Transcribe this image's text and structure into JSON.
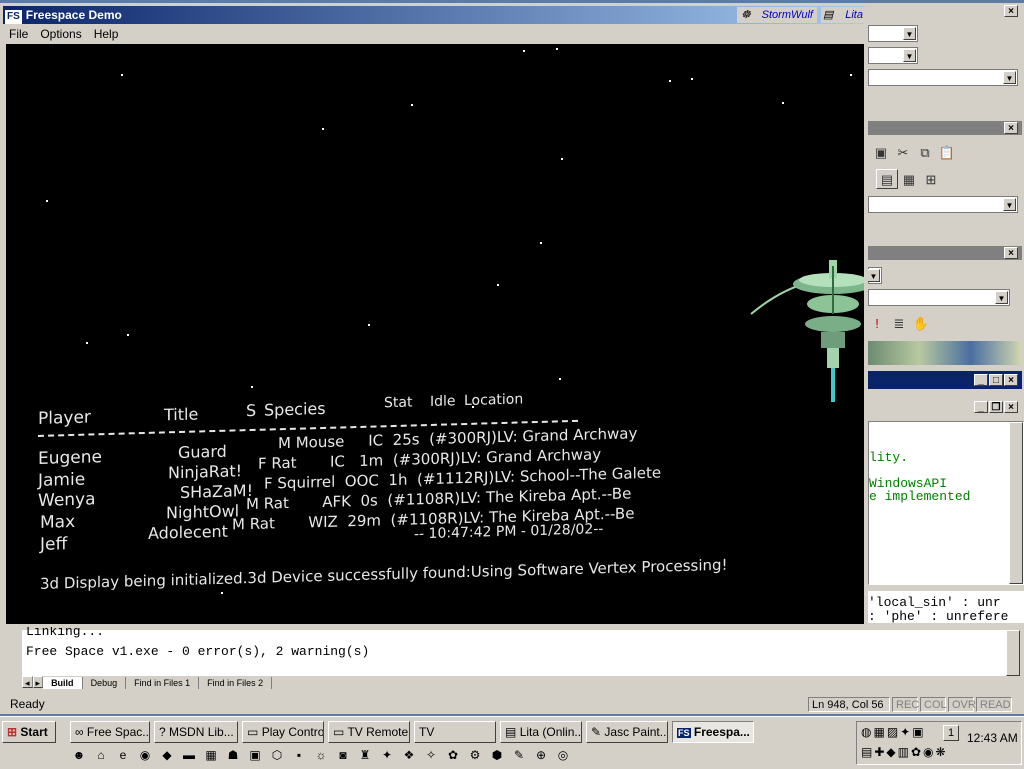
{
  "game": {
    "title": "Freespace Demo",
    "icon_label": "FS",
    "menu": [
      "File",
      "Options",
      "Help"
    ],
    "users": [
      "StormWulf",
      "Lita"
    ],
    "header": {
      "player": "Player",
      "title": "Title",
      "sex": "S",
      "species": "Species",
      "stat": "Stat",
      "idle": "Idle",
      "location": "Location"
    },
    "rows": [
      {
        "player": "Eugene",
        "title": "Guard",
        "rest": "M Mouse     IC  25s  (#300RJ)LV: Grand Archway"
      },
      {
        "player": "Jamie",
        "title": "NinjaRat!",
        "rest": "F Rat       IC   1m  (#300RJ)LV: Grand Archway"
      },
      {
        "player": "Wenya",
        "title": "SHaZaM!",
        "rest": "F Squirrel  OOC  1h  (#1112RJ)LV: School--The Galete"
      },
      {
        "player": "Max",
        "title": "NightOwl",
        "rest": "M Rat       AFK  0s  (#1108R)LV: The Kireba Apt.--Be"
      },
      {
        "player": "Jeff",
        "title": "Adolecent",
        "rest": "M Rat       WIZ  29m  (#1108R)LV: The Kireba Apt.--Be"
      }
    ],
    "timestamp": "-- 10:47:42 PM - 01/28/02--",
    "status_message": "3d Display being initialized.3d Device successfully found:Using Software Vertex Processing!"
  },
  "code": {
    "line1": "lity.",
    "line2": "WindowsAPI",
    "line3": "e implemented",
    "warn1": "'local_sin' : unr",
    "warn2": ": 'phe' : unrefere"
  },
  "output": {
    "prev_line": "Linking...",
    "result": "Free Space v1.exe - 0 error(s), 2 warning(s)"
  },
  "tabs": [
    "Build",
    "Debug",
    "Find in Files 1",
    "Find in Files 2"
  ],
  "status": {
    "ready": "Ready",
    "position": "Ln 948, Col 56",
    "rec": "REC",
    "col": "COL",
    "ovr": "OVR",
    "read": "READ"
  },
  "taskbar": {
    "start": "Start",
    "tasks": [
      "Free Spac...",
      "MSDN Lib...",
      "Play Control",
      "TV Remote",
      "TV",
      "Lita (Onlin...",
      "Jasc Paint...",
      "Freespa..."
    ],
    "clock": "12:43 AM",
    "tray_number": "1"
  },
  "colors": {
    "titlebar_start": "#0a246a",
    "titlebar_end": "#a6caf0",
    "station": "#9fd6a8"
  }
}
